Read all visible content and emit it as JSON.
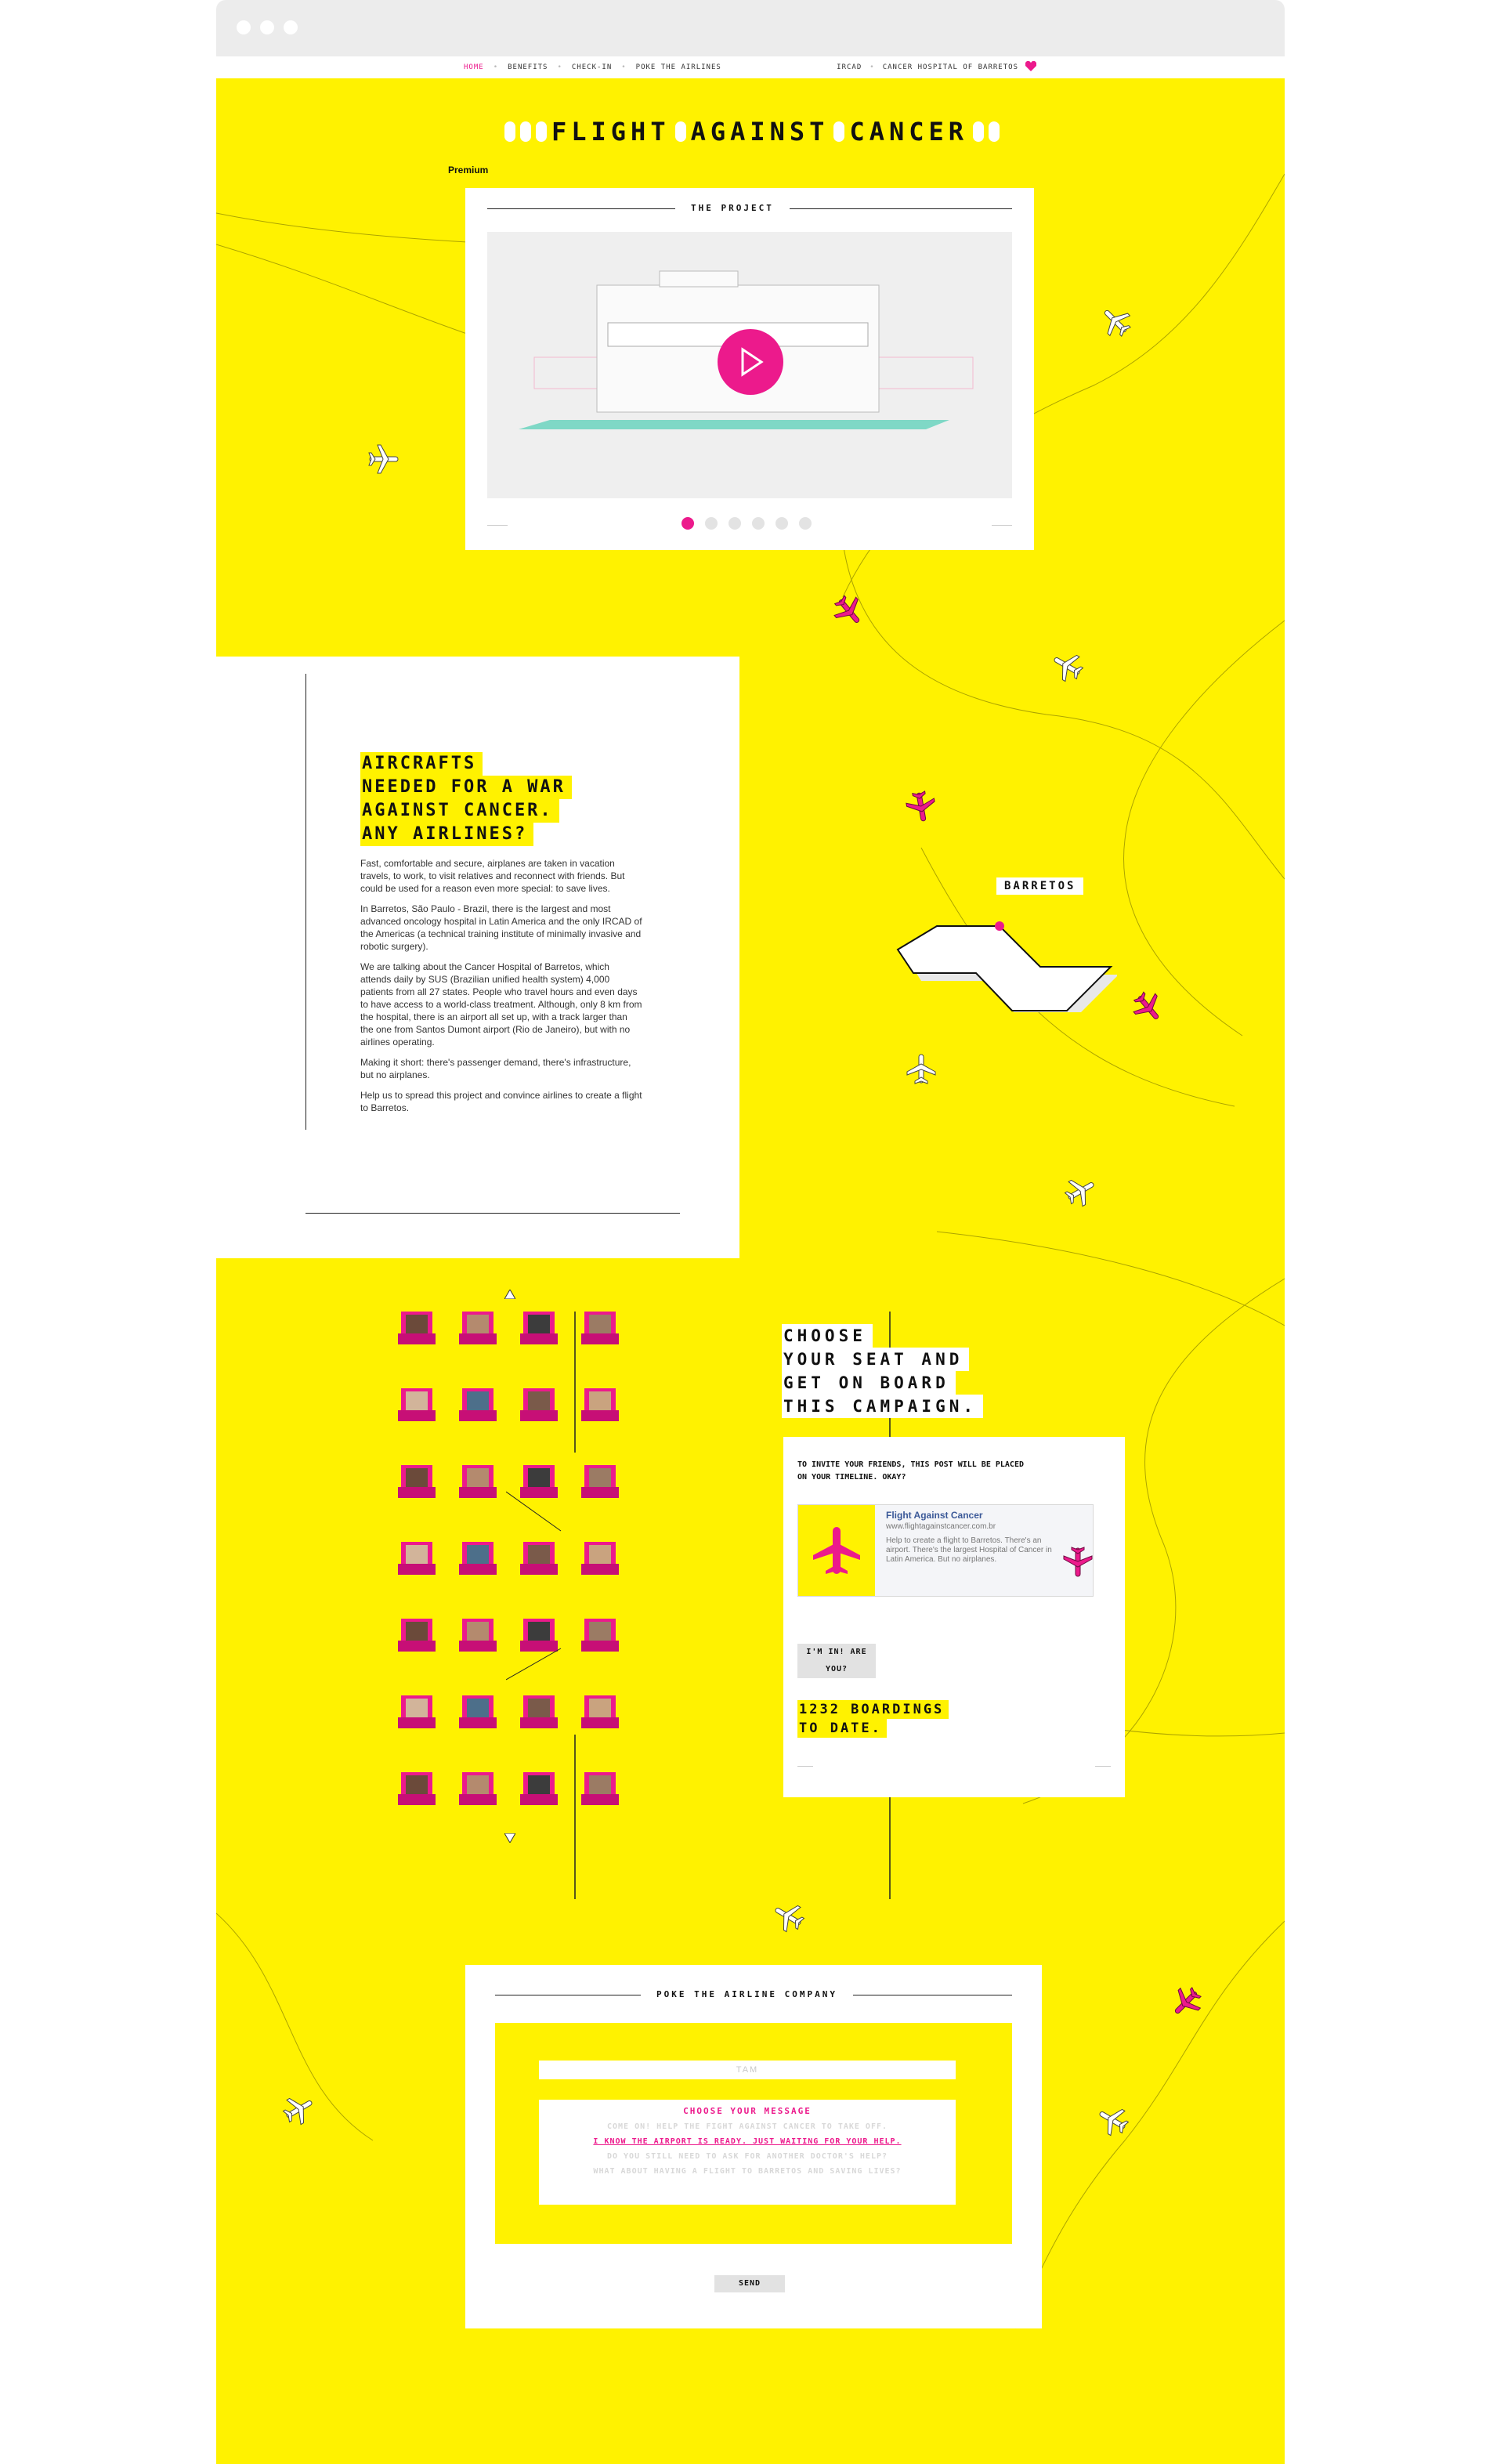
{
  "nav": {
    "left_items": [
      "Home",
      "Benefits",
      "Check-in",
      "Poke the airlines"
    ],
    "right_items": [
      "IRCAD",
      "Cancer Hospital of Barretos"
    ]
  },
  "logo": {
    "words": [
      "FLIGHT",
      "AGAINST",
      "CANCER"
    ]
  },
  "premium_label": "Premium",
  "project": {
    "title": "THE PROJECT",
    "slide_count": 6,
    "active_slide": 1
  },
  "article": {
    "headline": [
      "AIRCRAFTS",
      "NEEDED FOR A WAR",
      "AGAINST CANCER.",
      "ANY AIRLINES?"
    ],
    "paragraphs": [
      "Fast, comfortable and secure, airplanes are taken in vacation travels, to work, to visit relatives and reconnect with friends. But could be used for a reason even more special: to save lives.",
      "In Barretos, São Paulo - Brazil, there is the largest and most advanced oncology hospital in Latin America and the only IRCAD of the Americas (a technical training institute of minimally invasive and robotic surgery).",
      "We are talking about the Cancer Hospital of Barretos, which attends daily by SUS (Brazilian unified health system) 4,000 patients from all 27 states. People who travel hours and even days to have access to a world-class treatment. Although, only 8 km from the hospital, there is an airport all set up, with a track larger than the one from Santos Dumont airport (Rio de Janeiro), but with no airlines operating.",
      "Making it short: there's passenger demand, there's infrastructure, but no airplanes.",
      "Help us to spread this project and convince airlines to create a flight to Barretos."
    ]
  },
  "map": {
    "city_label": "BARRETOS"
  },
  "campaign": {
    "headline": [
      "CHOOSE",
      "YOUR SEAT AND",
      "GET ON BOARD",
      "THIS CAMPAIGN."
    ],
    "invite_text": "TO INVITE YOUR FRIENDS, THIS POST WILL BE PLACED ON YOUR TIMELINE. OKAY?",
    "fb_post": {
      "title": "Flight Against Cancer",
      "url": "www.flightagainstcancer.com.br",
      "description": "Help to create a flight to Barretos. There's an airport. There's the largest Hospital of Cancer in Latin America. But no airplanes."
    },
    "join_button": "I'M IN! ARE YOU?",
    "boardings": [
      "1232 BOARDINGS",
      "TO DATE."
    ]
  },
  "poke": {
    "title": "POKE THE AIRLINE COMPANY",
    "input_placeholder": "TAM",
    "choose_label": "CHOOSE YOUR MESSAGE",
    "messages": [
      "COME ON! HELP THE FIGHT AGAINST CANCER TO TAKE OFF.",
      "I KNOW THE AIRPORT IS READY. JUST WAITING FOR YOUR HELP.",
      "DO YOU STILL NEED TO ASK FOR ANOTHER DOCTOR'S HELP?",
      "WHAT ABOUT HAVING A FLIGHT TO BARRETOS AND SAVING LIVES?"
    ],
    "selected_index": 1,
    "send_button": "SEND"
  },
  "colors": {
    "brand_yellow": "#fff200",
    "accent_pink": "#ec1a8c"
  }
}
